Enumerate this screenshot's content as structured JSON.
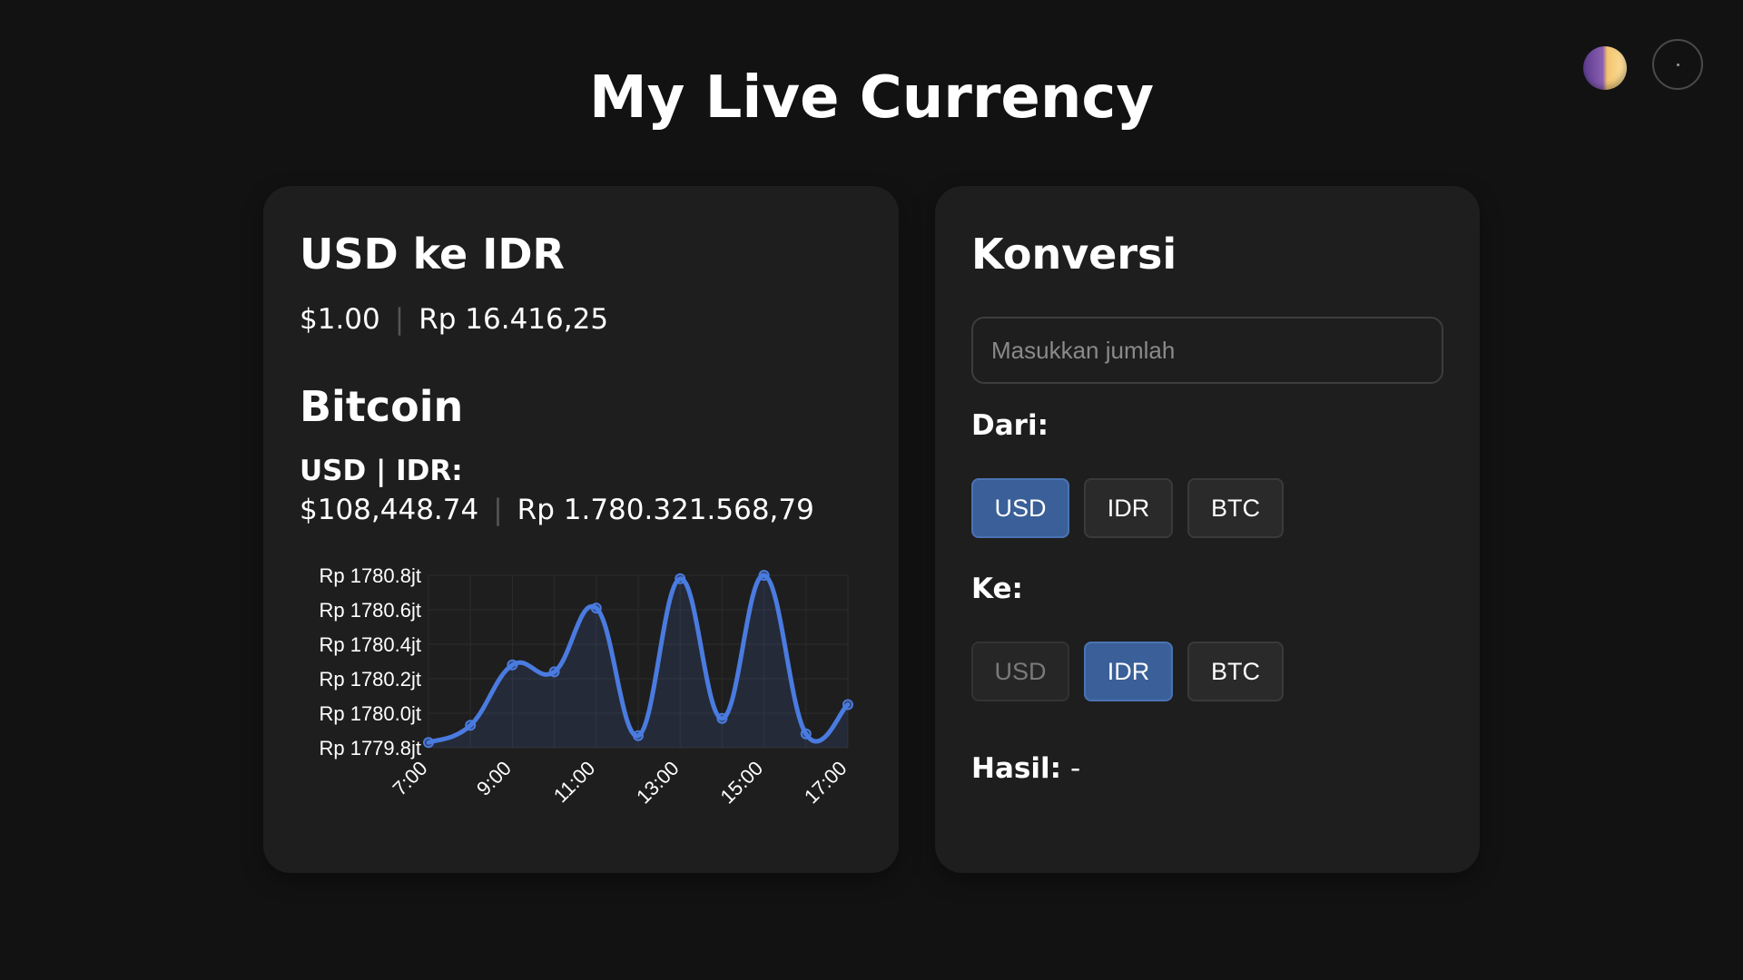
{
  "app": {
    "title": "My Live Currency"
  },
  "rate_card": {
    "title": "USD ke IDR",
    "usd_value": "$1.00",
    "idr_value": "Rp 16.416,25",
    "bitcoin_title": "Bitcoin",
    "bitcoin_subtitle": "USD | IDR:",
    "btc_usd": "$108,448.74",
    "btc_idr": "Rp 1.780.321.568,79"
  },
  "converter": {
    "title": "Konversi",
    "amount_placeholder": "Masukkan jumlah",
    "amount_value": "",
    "from_label": "Dari:",
    "to_label": "Ke:",
    "from_options": [
      {
        "label": "USD",
        "state": "active"
      },
      {
        "label": "IDR",
        "state": "normal"
      },
      {
        "label": "BTC",
        "state": "normal"
      }
    ],
    "to_options": [
      {
        "label": "USD",
        "state": "disabled"
      },
      {
        "label": "IDR",
        "state": "active"
      },
      {
        "label": "BTC",
        "state": "normal"
      }
    ],
    "result_label": "Hasil:",
    "result_value": "-"
  },
  "colors": {
    "background": "#121212",
    "card": "#1e1e1e",
    "accent": "#3a5f99",
    "line": "#4a7be0"
  },
  "icons": {
    "theme_toggle": "half-moon-theme-icon",
    "menu": "dot-menu-icon"
  },
  "chart_data": {
    "type": "line",
    "x": [
      "7:00",
      "8:00",
      "9:00",
      "10:00",
      "11:00",
      "12:00",
      "13:00",
      "14:00",
      "15:00",
      "16:00",
      "17:00"
    ],
    "x_tick_labels": [
      "7:00",
      "9:00",
      "11:00",
      "13:00",
      "15:00",
      "17:00"
    ],
    "values": [
      1779.83,
      1779.93,
      1780.28,
      1780.24,
      1780.61,
      1779.87,
      1780.78,
      1779.97,
      1780.8,
      1779.88,
      1780.05
    ],
    "ylim": [
      1779.8,
      1780.8
    ],
    "y_tick_values": [
      1779.8,
      1780.0,
      1780.2,
      1780.4,
      1780.6,
      1780.8
    ],
    "y_tick_labels": [
      "Rp 1779.8jt",
      "Rp 1780.0jt",
      "Rp 1780.2jt",
      "Rp 1780.4jt",
      "Rp 1780.6jt",
      "Rp 1780.8jt"
    ],
    "grid": true,
    "curve": "smooth",
    "fill": true
  }
}
